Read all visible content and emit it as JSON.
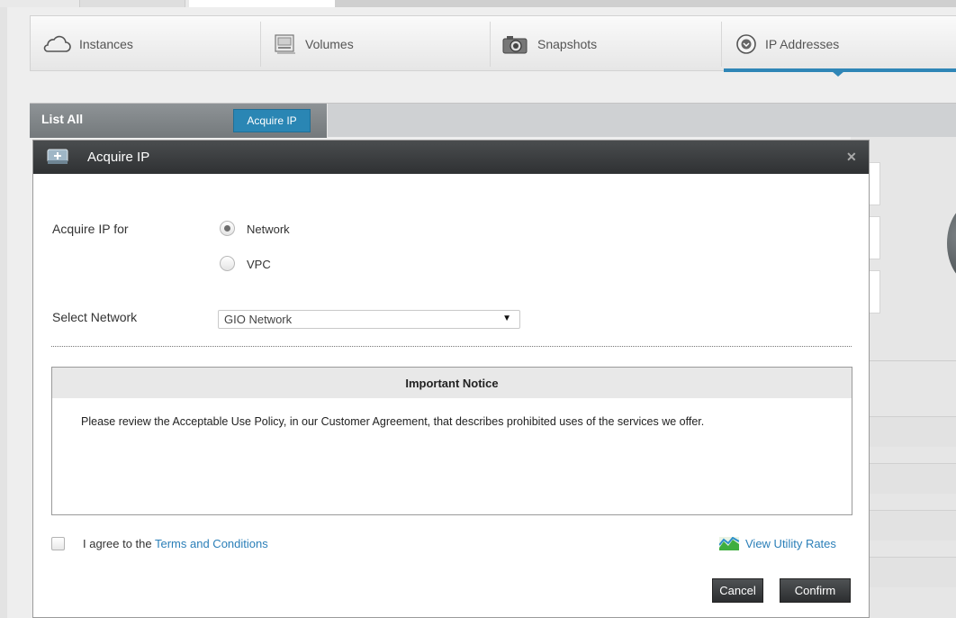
{
  "tabs": [
    {
      "label": "Instances",
      "icon": "cloud-icon"
    },
    {
      "label": "Volumes",
      "icon": "volume-icon"
    },
    {
      "label": "Snapshots",
      "icon": "camera-icon"
    },
    {
      "label": "IP Addresses",
      "icon": "ip-address-icon",
      "active": true
    }
  ],
  "list_header": {
    "title": "List All",
    "acquire_button": "Acquire IP"
  },
  "dialog": {
    "title": "Acquire IP",
    "acquire_for_label": "Acquire IP for",
    "options": [
      {
        "label": "Network",
        "checked": true
      },
      {
        "label": "VPC",
        "checked": false
      }
    ],
    "select_network_label": "Select Network",
    "selected_network": "GIO Network",
    "notice": {
      "title": "Important Notice",
      "body": "Please review the Acceptable Use Policy, in our Customer Agreement, that describes prohibited uses of the services we offer."
    },
    "agree_prefix": "I agree to the ",
    "agree_link": "Terms and Conditions",
    "rates_link": "View Utility Rates",
    "cancel": "Cancel",
    "confirm": "Confirm"
  },
  "colors": {
    "accent": "#2f86b7",
    "link": "#2b7fb8",
    "header_dark": "#3a3d3f"
  }
}
